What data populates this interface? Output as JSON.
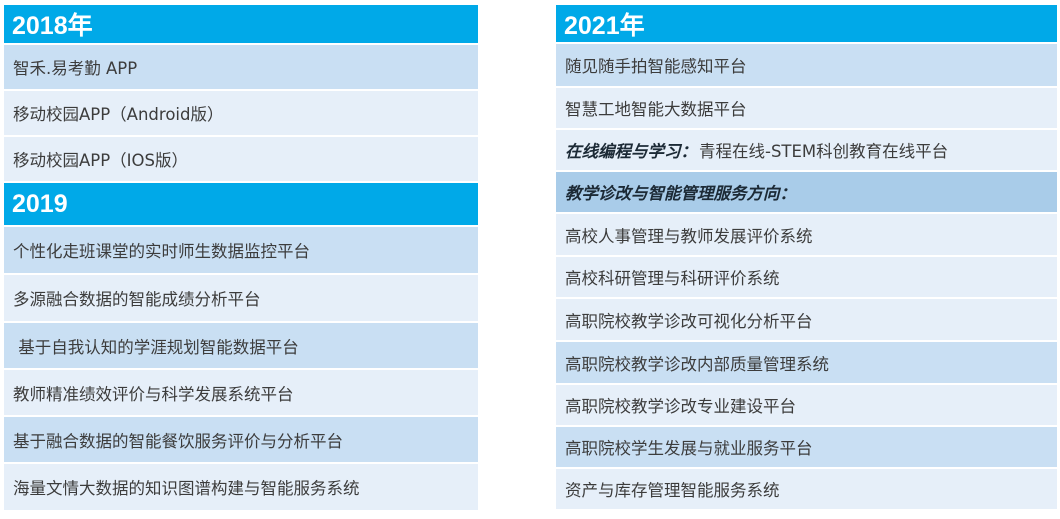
{
  "left": {
    "sections": [
      {
        "year": "2018年",
        "items": [
          "智禾.易考勤 APP",
          "移动校园APP（Android版）",
          "移动校园APP（IOS版）"
        ]
      },
      {
        "year": "2019",
        "items": [
          "个性化走班课堂的实时师生数据监控平台",
          "多源融合数据的智能成绩分析平台",
          " 基于自我认知的学涯规划智能数据平台",
          "教师精准绩效评价与科学发展系统平台",
          "基于融合数据的智能餐饮服务评价与分析平台",
          "海量文情大数据的知识图谱构建与智能服务系统"
        ]
      }
    ]
  },
  "right": {
    "year": "2021年",
    "items": [
      "随见随手拍智能感知平台",
      "智慧工地智能大数据平台"
    ],
    "online_heading": "在线编程与学习：",
    "online_text": "青程在线-STEM科创教育在线平台",
    "diagnosis_heading": "教学诊改与智能管理服务方向：",
    "diagnosis_items": [
      "高校人事管理与教师发展评价系统",
      "高校科研管理与科研评价系统",
      "高职院校教学诊改可视化分析平台",
      "高职院校教学诊改内部质量管理系统",
      "高职院校教学诊改专业建设平台",
      "高职院校学生发展与就业服务平台",
      "资产与库存管理智能服务系统"
    ]
  }
}
